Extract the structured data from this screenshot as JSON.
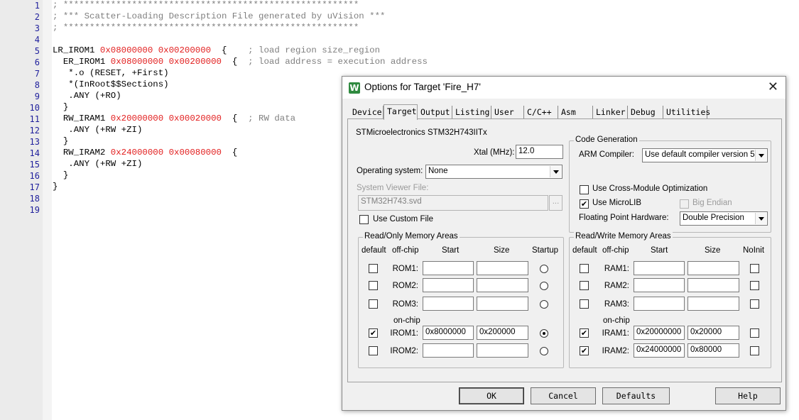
{
  "editor": {
    "line_numbers": [
      "1",
      "2",
      "3",
      "4",
      "5",
      "6",
      "7",
      "8",
      "9",
      "10",
      "11",
      "12",
      "13",
      "14",
      "15",
      "16",
      "17",
      "18",
      "19"
    ],
    "lines": [
      [
        {
          "t": "; ********************************************************",
          "c": "comment"
        }
      ],
      [
        {
          "t": "; *** Scatter-Loading Description File generated by uVision ***",
          "c": "comment"
        }
      ],
      [
        {
          "t": "; ********************************************************",
          "c": "comment"
        }
      ],
      [],
      [
        {
          "t": "LR_IROM1 ",
          "c": ""
        },
        {
          "t": "0x08000000",
          "c": "num"
        },
        {
          "t": " ",
          "c": ""
        },
        {
          "t": "0x00200000",
          "c": "num"
        },
        {
          "t": "  {    ",
          "c": ""
        },
        {
          "t": "; load region size_region",
          "c": "comment"
        }
      ],
      [
        {
          "t": "  ER_IROM1 ",
          "c": ""
        },
        {
          "t": "0x08000000",
          "c": "num"
        },
        {
          "t": " ",
          "c": ""
        },
        {
          "t": "0x00200000",
          "c": "num"
        },
        {
          "t": "  {  ",
          "c": ""
        },
        {
          "t": "; load address = execution address",
          "c": "comment"
        }
      ],
      [
        {
          "t": "   *.o (RESET, +First)",
          "c": ""
        }
      ],
      [
        {
          "t": "   *(InRoot$$Sections)",
          "c": ""
        }
      ],
      [
        {
          "t": "   .ANY (+RO)",
          "c": ""
        }
      ],
      [
        {
          "t": "  }",
          "c": ""
        }
      ],
      [
        {
          "t": "  RW_IRAM1 ",
          "c": ""
        },
        {
          "t": "0x20000000",
          "c": "num"
        },
        {
          "t": " ",
          "c": ""
        },
        {
          "t": "0x00020000",
          "c": "num"
        },
        {
          "t": "  {  ",
          "c": ""
        },
        {
          "t": "; RW data",
          "c": "comment"
        }
      ],
      [
        {
          "t": "   .ANY (+RW +ZI)",
          "c": ""
        }
      ],
      [
        {
          "t": "  }",
          "c": ""
        }
      ],
      [
        {
          "t": "  RW_IRAM2 ",
          "c": ""
        },
        {
          "t": "0x24000000",
          "c": "num"
        },
        {
          "t": " ",
          "c": ""
        },
        {
          "t": "0x00080000",
          "c": "num"
        },
        {
          "t": "  {",
          "c": ""
        }
      ],
      [
        {
          "t": "   .ANY (+RW +ZI)",
          "c": ""
        }
      ],
      [
        {
          "t": "  }",
          "c": ""
        }
      ],
      [
        {
          "t": "}",
          "c": ""
        }
      ],
      [],
      []
    ]
  },
  "dialog": {
    "title": "Options for Target 'Fire_H7'",
    "close_glyph": "✕",
    "app_icon_glyph": "W",
    "tabs": [
      "Device",
      "Target",
      "Output",
      "Listing",
      "User",
      "C/C++",
      "Asm",
      "Linker",
      "Debug",
      "Utilities"
    ],
    "active_tab": "Target",
    "device_name": "STMicroelectronics STM32H743IITx",
    "xtal_label": "Xtal (MHz):",
    "xtal_value": "12.0",
    "os_label": "Operating system:",
    "os_value": "None",
    "sysviewer_label": "System Viewer File:",
    "sysviewer_value": "STM32H743.svd",
    "browse_label": "...",
    "custom_file_label": "Use Custom File",
    "codegen": {
      "title": "Code Generation",
      "arm_compiler_label": "ARM Compiler:",
      "arm_compiler_value": "Use default compiler version 5",
      "cross_module_label": "Use Cross-Module Optimization",
      "microlib_label": "Use MicroLIB",
      "big_endian_label": "Big Endian",
      "fpu_label": "Floating Point Hardware:",
      "fpu_value": "Double Precision"
    },
    "ro_memory": {
      "title": "Read/Only Memory Areas",
      "headers": {
        "default": "default",
        "offchip": "off-chip",
        "start": "Start",
        "size": "Size",
        "last": "Startup"
      },
      "onchip_label": "on-chip",
      "rows": [
        {
          "label": "ROM1:",
          "start": "",
          "size": "",
          "default": false,
          "startup": false
        },
        {
          "label": "ROM2:",
          "start": "",
          "size": "",
          "default": false,
          "startup": false
        },
        {
          "label": "ROM3:",
          "start": "",
          "size": "",
          "default": false,
          "startup": false
        },
        {
          "label": "IROM1:",
          "start": "0x8000000",
          "size": "0x200000",
          "default": true,
          "startup": true
        },
        {
          "label": "IROM2:",
          "start": "",
          "size": "",
          "default": false,
          "startup": false
        }
      ]
    },
    "rw_memory": {
      "title": "Read/Write Memory Areas",
      "headers": {
        "default": "default",
        "offchip": "off-chip",
        "start": "Start",
        "size": "Size",
        "last": "NoInit"
      },
      "onchip_label": "on-chip",
      "rows": [
        {
          "label": "RAM1:",
          "start": "",
          "size": "",
          "default": false,
          "noinit": false
        },
        {
          "label": "RAM2:",
          "start": "",
          "size": "",
          "default": false,
          "noinit": false
        },
        {
          "label": "RAM3:",
          "start": "",
          "size": "",
          "default": false,
          "noinit": false
        },
        {
          "label": "IRAM1:",
          "start": "0x20000000",
          "size": "0x20000",
          "default": true,
          "noinit": false
        },
        {
          "label": "IRAM2:",
          "start": "0x24000000",
          "size": "0x80000",
          "default": true,
          "noinit": false
        }
      ]
    },
    "buttons": {
      "ok": "OK",
      "cancel": "Cancel",
      "defaults": "Defaults",
      "help": "Help"
    },
    "check_glyph": "✔"
  }
}
